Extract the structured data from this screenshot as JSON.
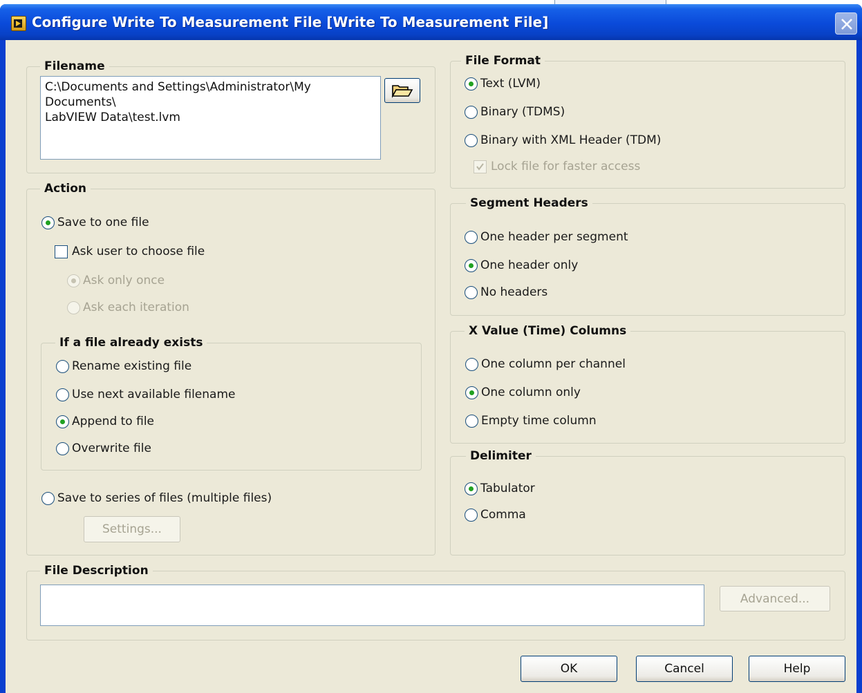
{
  "window": {
    "title": "Configure Write To Measurement File [Write To Measurement File]"
  },
  "filename": {
    "label": "Filename",
    "value": "C:\\Documents and Settings\\Administrator\\My Documents\\\nLabVIEW Data\\test.lvm"
  },
  "file_format": {
    "label": "File Format",
    "options": [
      {
        "label": "Text (LVM)",
        "selected": true
      },
      {
        "label": "Binary (TDMS)",
        "selected": false
      },
      {
        "label": "Binary with XML Header (TDM)",
        "selected": false
      }
    ],
    "lock_file_label": "Lock file for faster access",
    "lock_file_checked": true
  },
  "action": {
    "label": "Action",
    "save_one_file_label": "Save to one file",
    "ask_user_label": "Ask user to choose file",
    "ask_only_once_label": "Ask only once",
    "ask_each_iteration_label": "Ask each iteration",
    "save_series_label": "Save to series of files (multiple files)",
    "settings_button": "Settings..."
  },
  "if_exists": {
    "label": "If a file already exists",
    "options": [
      {
        "label": "Rename existing file",
        "selected": false
      },
      {
        "label": "Use next available filename",
        "selected": false
      },
      {
        "label": "Append to file",
        "selected": true
      },
      {
        "label": "Overwrite file",
        "selected": false
      }
    ]
  },
  "segment_headers": {
    "label": "Segment Headers",
    "options": [
      {
        "label": "One header per segment",
        "selected": false
      },
      {
        "label": "One header only",
        "selected": true
      },
      {
        "label": "No headers",
        "selected": false
      }
    ]
  },
  "x_value_columns": {
    "label": "X Value (Time) Columns",
    "options": [
      {
        "label": "One column per channel",
        "selected": false
      },
      {
        "label": "One column only",
        "selected": true
      },
      {
        "label": "Empty time column",
        "selected": false
      }
    ]
  },
  "delimiter": {
    "label": "Delimiter",
    "options": [
      {
        "label": "Tabulator",
        "selected": true
      },
      {
        "label": "Comma",
        "selected": false
      }
    ]
  },
  "file_description": {
    "label": "File Description",
    "value": "",
    "advanced_button": "Advanced..."
  },
  "footer": {
    "ok": "OK",
    "cancel": "Cancel",
    "help": "Help"
  },
  "icons": {
    "app": "labview-vi-icon",
    "close": "close-icon",
    "browse": "folder-open-icon"
  }
}
